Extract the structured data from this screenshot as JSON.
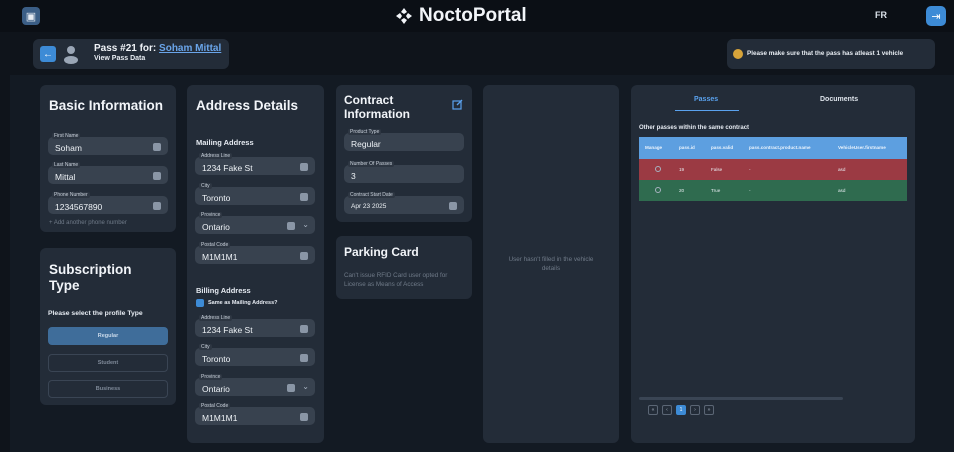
{
  "app": {
    "brand": "NoctoPortal",
    "language": "FR"
  },
  "header": {
    "title_prefix": "Pass #21 for:",
    "user_name": "Soham Mittal",
    "subtitle": "View Pass Data",
    "warning": "Please make sure that the pass has atleast 1 vehicle"
  },
  "basic_info": {
    "title": "Basic Information",
    "first_name": {
      "label": "First Name",
      "value": "Soham"
    },
    "last_name": {
      "label": "Last Name",
      "value": "Mittal"
    },
    "phone": {
      "label": "Phone Number",
      "value": "1234567890"
    },
    "add_phone": "+ Add another phone number"
  },
  "subscription": {
    "title": "Subscription Type",
    "prompt": "Please select the profile Type",
    "options": [
      {
        "label": "Regular",
        "selected": true
      },
      {
        "label": "Student",
        "selected": false
      },
      {
        "label": "Business",
        "selected": false
      }
    ]
  },
  "address": {
    "title": "Address Details",
    "mailing_title": "Mailing Address",
    "mailing": {
      "line": {
        "label": "Address Line",
        "value": "1234 Fake St"
      },
      "city": {
        "label": "City",
        "value": "Toronto"
      },
      "province": {
        "label": "Province",
        "value": "Ontario"
      },
      "postal": {
        "label": "Postal Code",
        "value": "M1M1M1"
      }
    },
    "billing_title": "Billing Address",
    "same_as_mailing": "Same as Mailing Address?",
    "billing": {
      "line": {
        "label": "Address Line",
        "value": "1234 Fake St"
      },
      "city": {
        "label": "City",
        "value": "Toronto"
      },
      "province": {
        "label": "Province",
        "value": "Ontario"
      },
      "postal": {
        "label": "Postal Code",
        "value": "M1M1M1"
      }
    }
  },
  "contract": {
    "title_line1": "Contract",
    "title_line2": "Information",
    "product_type": {
      "label": "Product Type",
      "value": "Regular"
    },
    "passes": {
      "label": "Number Of Passes",
      "value": "3"
    },
    "start_date": {
      "label": "Contract Start Date",
      "value": "Apr 23 2025"
    }
  },
  "parking": {
    "title": "Parking Card",
    "message": "Can't issue RFID Card user opted for License as Means of Access"
  },
  "vehicle": {
    "message": "User hasn't filled in the vehicle details"
  },
  "passes_panel": {
    "tabs": [
      "Passes",
      "Documents"
    ],
    "heading": "Other passes within the same contract",
    "columns": [
      "Manage",
      "pass.id",
      "pass.valid",
      "pass.contract.product.name",
      "VehicleUser.firstname"
    ],
    "rows": [
      {
        "id": "19",
        "valid": "False",
        "product": "-",
        "firstname": "asd",
        "color": "#9b3a43"
      },
      {
        "id": "20",
        "valid": "True",
        "product": "-",
        "firstname": "asd",
        "color": "#2f6b4f"
      }
    ],
    "pager": {
      "current": "1"
    }
  },
  "colors": {
    "accent": "#3d8bd6",
    "false_row": "#9b3a43",
    "true_row": "#2f6b4f",
    "header": "#5d9fe0"
  }
}
